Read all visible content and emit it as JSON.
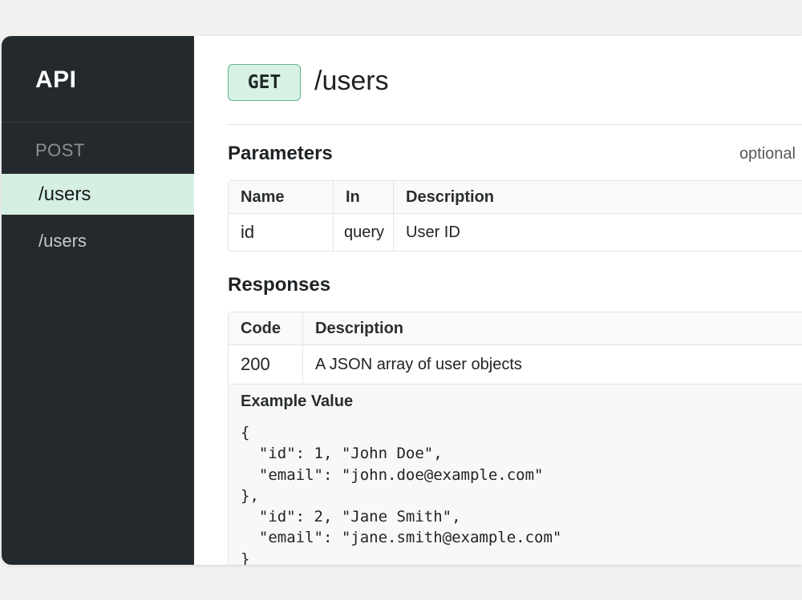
{
  "sidebar": {
    "brand": "API",
    "section_label": "POST",
    "items": [
      {
        "label": "/users",
        "active": true
      },
      {
        "label": "/users",
        "active": false
      }
    ]
  },
  "endpoint": {
    "method": "GET",
    "path": "/users"
  },
  "parameters": {
    "title": "Parameters",
    "optional_label": "optional",
    "columns": [
      "Name",
      "In",
      "Description"
    ],
    "rows": [
      {
        "name": "id",
        "in": "query",
        "description": "User ID"
      }
    ]
  },
  "responses": {
    "title": "Responses",
    "columns": [
      "Code",
      "Description"
    ],
    "rows": [
      {
        "code": "200",
        "description": "A JSON array of user objects"
      }
    ],
    "example": {
      "title": "Example Value",
      "lines": [
        "{",
        "  \"id\": 1, \"John Doe\",",
        "  \"email\": \"john.doe@example.com\"",
        "},",
        "  \"id\": 2, \"Jane Smith\",",
        "  \"email\": \"jane.smith@example.com\"",
        "}"
      ]
    }
  },
  "colors": {
    "sidebar_bg": "#24292d",
    "active_item_bg": "#d5efe2",
    "method_badge_bg": "#d8f1e4",
    "method_badge_border": "#5fb38c"
  }
}
